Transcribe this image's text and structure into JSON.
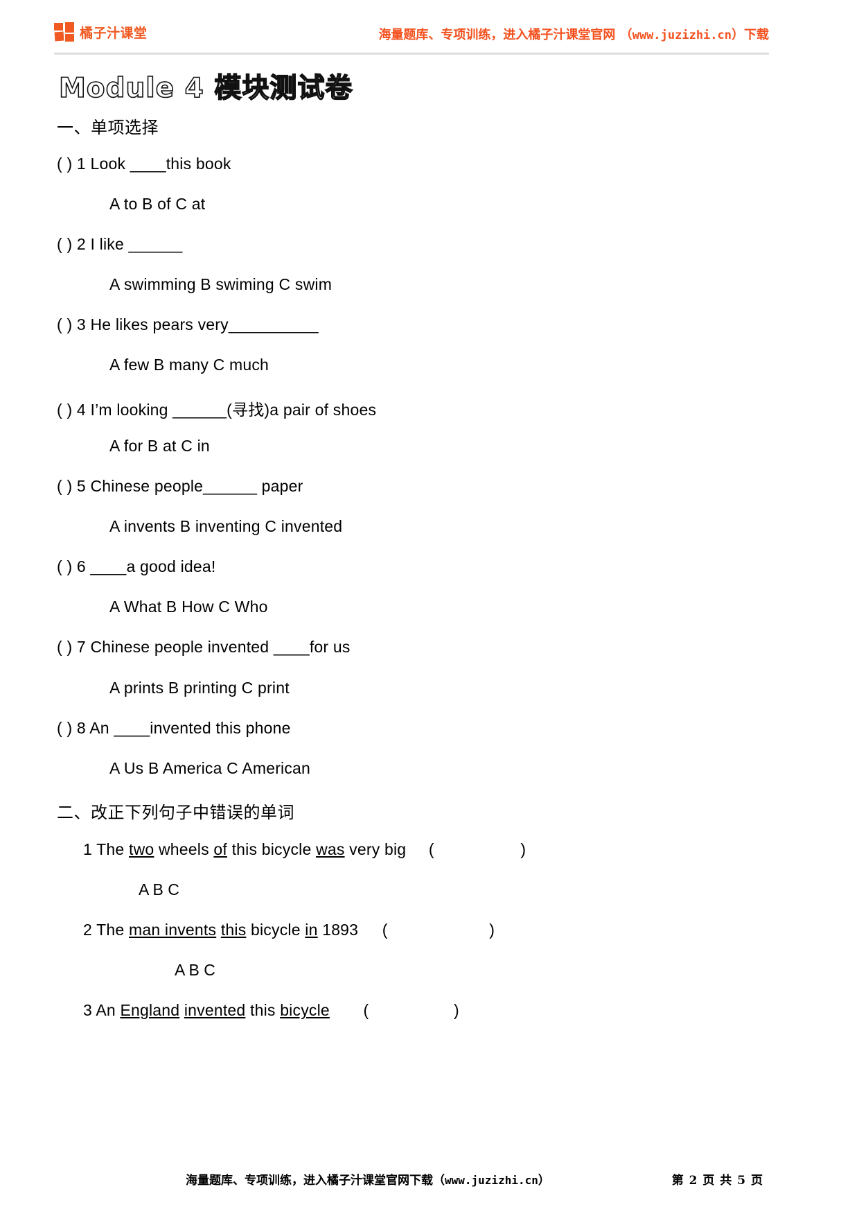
{
  "header": {
    "logo_text": "橘子汁课堂",
    "promo_prefix": "海量题库、专项训练，进入橘子汁课堂官网 （",
    "promo_url": "www.juzizhi.cn",
    "promo_suffix": "）下载",
    "accent_color": "#F4511E"
  },
  "title": "Module  4   模块测试卷",
  "sections": [
    {
      "heading": "一、单项选择",
      "questions": [
        {
          "stem": "(        ) 1 Look ____this book",
          "options": "A    to        B    of      C at"
        },
        {
          "stem": "(        ) 2 I like ______",
          "options": "A    swimming        B swiming     C    swim"
        },
        {
          "stem": "(        ) 3 He likes pears very__________",
          "options": "A    few          B    many     C    much"
        },
        {
          "stem": "(        ) 4 I’m looking ______(寻找)a pair of shoes",
          "options": "A    for          B    at        C in"
        },
        {
          "stem": "(        ) 5 Chinese people______ paper",
          "options": "A    invents     B    inventing     C invented"
        },
        {
          "stem": "(        ) 6 ____a good idea!",
          "options": "A    What       B    How      C Who"
        },
        {
          "stem": "(        ) 7 Chinese people invented ____for us",
          "options": "A    prints     B    printing     C    print"
        },
        {
          "stem": "(        ) 8 An ____invented this phone",
          "options": "A    Us      B    America    C American"
        }
      ]
    },
    {
      "heading": "二、改正下列句子中错误的单词",
      "items": [
        {
          "number": "1 The ",
          "u1": "two",
          "mid1": " wheels ",
          "u2": "of",
          "mid2": " this bicycle ",
          "u3": "was",
          "tail": " very big",
          "paren_open": "(",
          "paren_close": ")",
          "marks": "A                  B                     C"
        },
        {
          "number": "2 The ",
          "u1": "man invents",
          "mid1": " ",
          "u2": "this",
          "mid2": " bicycle ",
          "u3": "in",
          "tail": " 1893",
          "paren_open": "(",
          "paren_close": ")",
          "marks": "A          B          C"
        },
        {
          "number": "3 An ",
          "u1": "England",
          "mid1": " ",
          "u2": "invented",
          "mid2": " this ",
          "u3": "bicycle",
          "tail": "",
          "paren_open": "(",
          "paren_close": ")",
          "marks": ""
        }
      ]
    }
  ],
  "footer": {
    "text_prefix": "海量题库、专项训练，进入橘子汁课堂官网下载（",
    "url": "www.juzizhi.cn",
    "text_suffix": "）",
    "page_label_1": "第 ",
    "page_current": "2",
    "page_label_2": " 页 共 ",
    "page_total": "5",
    "page_label_3": " 页"
  }
}
